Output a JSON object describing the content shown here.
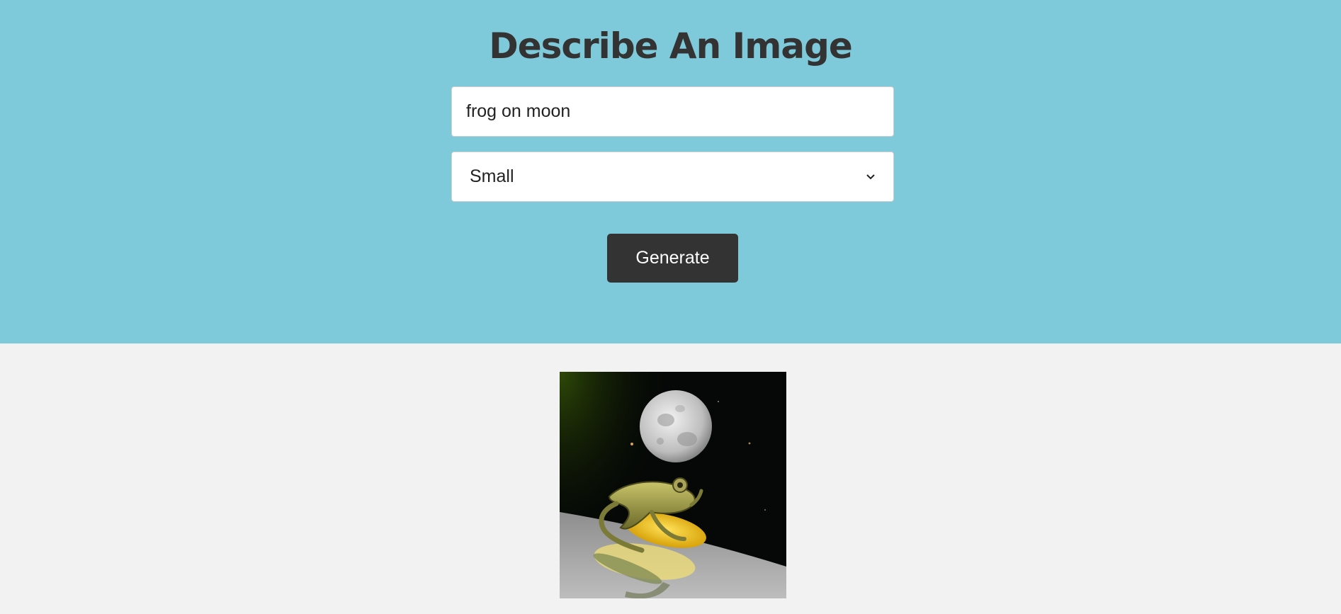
{
  "header": {
    "title": "Describe An Image"
  },
  "form": {
    "prompt_value": "frog on moon",
    "size_selected": "Small",
    "generate_label": "Generate"
  },
  "colors": {
    "hero_background": "#7ec9da",
    "page_background": "#f2f2f2",
    "title_text": "#333333",
    "button_background": "#333333",
    "button_text": "#ffffff"
  },
  "icons": {
    "select_arrow": "chevron-down-icon"
  }
}
